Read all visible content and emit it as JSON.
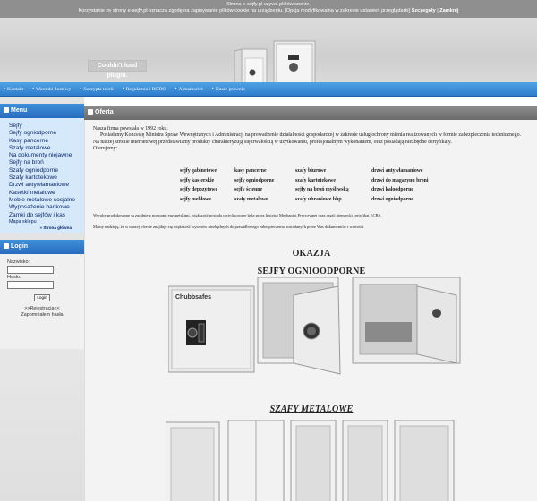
{
  "cookie": {
    "line1": "Strona e-sejfy.pl używa plików cookie.",
    "line2": "Korzystanie ze strony e-sejfy.pl oznacza zgodę na zapisywanie plików cookie na urządzeniu. [Opcja modyfikowalna w zakresie ustawień przeglądarki]",
    "details": "Szczegóły",
    "close": "Zamknij"
  },
  "header": {
    "plugin_message": "Couldn't load plugin."
  },
  "nav": {
    "items": [
      "Kontakt",
      "Warunki dostawy",
      "Szczypta teorii",
      "Regulamin i RODO",
      "Aktualności",
      "Nasze prawnia"
    ]
  },
  "sidebar": {
    "menu_title": "Menu",
    "menu_items": [
      "Sejfy",
      "Sejfy ogniodporne",
      "Kasy pancerne",
      "Szafy metalowe",
      "Na dokumenty niejawne",
      "Sejfy na broń",
      "Szafy ogniodporne",
      "Szafy kartotekowe",
      "Drzwi antywłamaniowe",
      "Kasetki metalowe",
      "Meble metalowe socjalne",
      "Wyposażenie bankowe",
      "Zamki do sejfów i kas"
    ],
    "map_link": "Mapa sklepu",
    "home_link": "» Strona główna",
    "login_title": "Login",
    "username_label": "Nazwisko:",
    "password_label": "Hasło:",
    "login_button": "Login",
    "register_link": ">>Rejestracja<<",
    "forgot_link": "Zapomniałem hasła"
  },
  "offer": {
    "title": "Oferta",
    "intro1": "Nasza firma powstała w 1992 roku.",
    "intro2": "Posiadamy Koncesję Ministra Spraw Wewnętrznych i Administracji na prowadzenie działalności gospodarczej w zakresie usług ochrony mienia realizowanych w formie zabezpieczenia technicznego.",
    "intro3": "Na naszej stronie internetowej przedstawiamy produkty charakteryzują się trwałością w użytkowaniu, profesjonalnym wykonaniem, oraz posiadają niezbędne certyfikaty.",
    "intro4": "Oferujemy:",
    "products": [
      [
        "sejfy gabinetowe",
        "sejfy kasjerskie",
        "sejfy depozytowe",
        "sejfy meblowe"
      ],
      [
        "kasy pancerne",
        "sejfy ogniodporne",
        "sejfy ścienne",
        "szafy metalowe"
      ],
      [
        "szafy biurowe",
        "szafy kartotekowe",
        "sejfy na broń myśliwską",
        "szafy ubraniowe bhp"
      ],
      [
        "drzwi antywłamaniowe",
        "drzwi do magazynu broni",
        "drzwi kaloodporne",
        "drzwi ogniodporne"
      ]
    ],
    "note1": "Wyroby produkowane są zgodnie z normami europejskimi, większość posiada certyfikowane była przez Instytut Mechaniki Precyzyjnej oraz część niemiecki certyfikat ECBS.",
    "note2": "Mamy nadzieję, że w naszej ofercie znajduje się większość wyrobów niezbędnych do prawidłowego zabezpieczenia posiadanych przez Was dokumentów i wartości.",
    "heading1": "OKAZJA",
    "heading2": "SEJFY OGNIOODPORNE",
    "heading3": "SZAFY METALOWE",
    "safe_brand": "Chubbsafes"
  }
}
